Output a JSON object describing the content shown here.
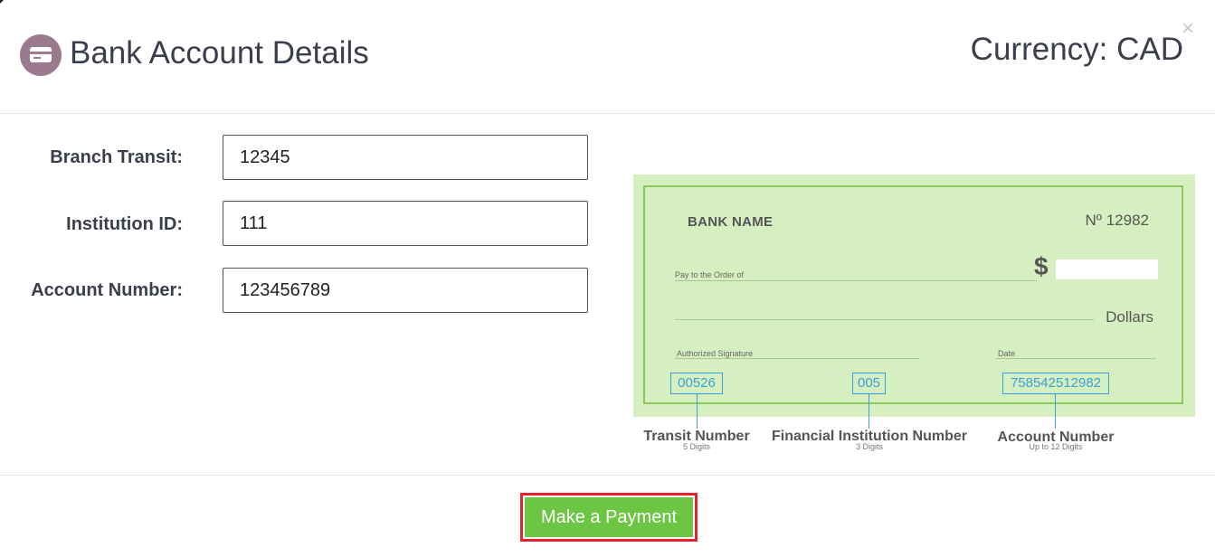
{
  "header": {
    "title": "Bank Account Details",
    "currency": "Currency: CAD",
    "close_glyph": "×",
    "icon": "credit-card-icon",
    "icon_color": "#9b7a90"
  },
  "form": {
    "fields": [
      {
        "label": "Branch Transit:",
        "value": "12345"
      },
      {
        "label": "Institution ID:",
        "value": "111"
      },
      {
        "label": "Account Number:",
        "value": "123456789"
      }
    ]
  },
  "cheque": {
    "bank_name": "BANK NAME",
    "cheque_number": "Nº 12982",
    "pay_to": "Pay to the Order of",
    "dollar_sign": "$",
    "dollars": "Dollars",
    "signature": "Authorized Signature",
    "date": "Date",
    "transit_code": "00526",
    "institution_code": "005",
    "account_code": "758542512982",
    "captions": [
      {
        "title": "Transit Number",
        "subtitle": "5 Digits"
      },
      {
        "title": "Financial Institution Number",
        "subtitle": "3 Digits"
      },
      {
        "title": "Account Number",
        "subtitle": "Up to 12 Digits"
      }
    ],
    "background_color": "#d6efc0",
    "border_color": "#8cc85e",
    "code_color": "#3aa0d8"
  },
  "footer": {
    "button_label": "Make a Payment",
    "button_color": "#6cc644",
    "highlight_color": "#e8222a"
  }
}
